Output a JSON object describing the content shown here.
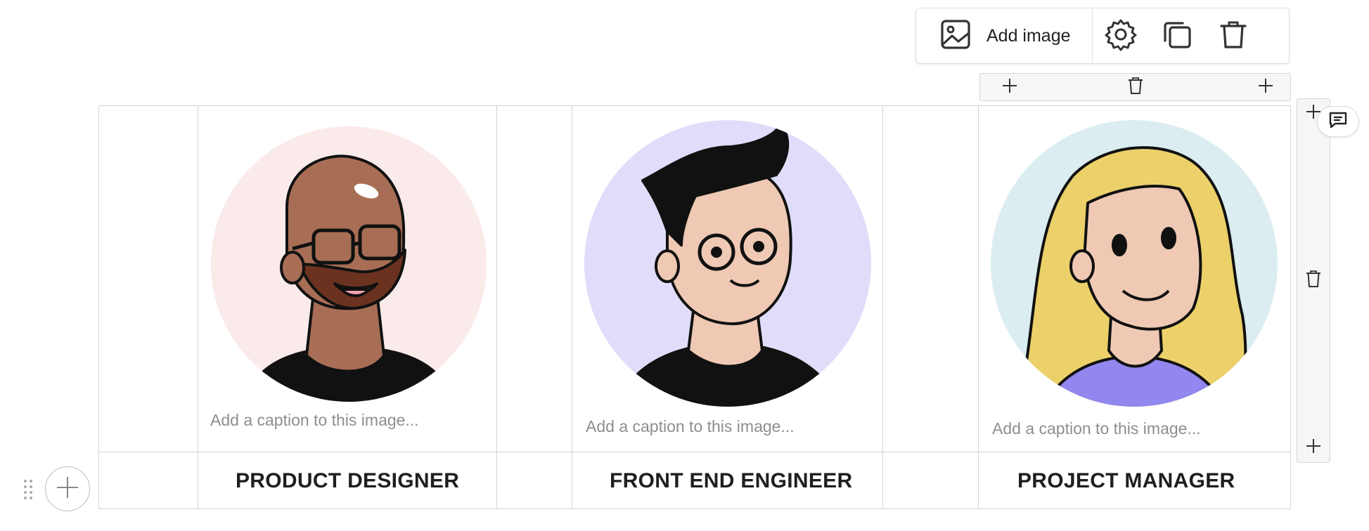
{
  "toolbar": {
    "add_image_label": "Add image",
    "icons": [
      "image-icon",
      "gear-icon",
      "duplicate-icon",
      "trash-icon"
    ]
  },
  "team": [
    {
      "role": "PRODUCT DESIGNER",
      "caption_placeholder": "Add a caption to this image...",
      "circle_color": "#fbeaea"
    },
    {
      "role": "FRONT END ENGINEER",
      "caption_placeholder": "Add a caption to this image...",
      "circle_color": "#dfddf9"
    },
    {
      "role": "PROJECT MANAGER",
      "caption_placeholder": "Add a caption to this image...",
      "circle_color": "#dbedf0"
    }
  ],
  "colors": {
    "border": "#d4d4d4",
    "caption_text": "#8e8e8e",
    "role_text": "#1f1f1f"
  }
}
